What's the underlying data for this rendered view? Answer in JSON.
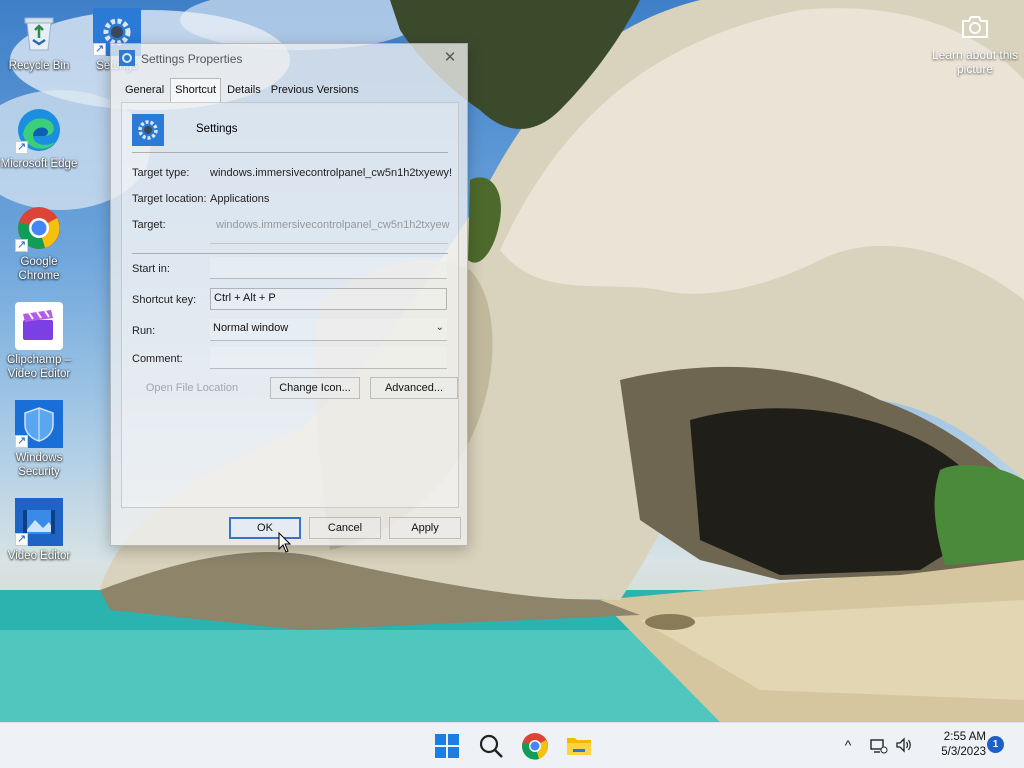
{
  "desktop": {
    "icons": [
      {
        "label": "Recycle Bin"
      },
      {
        "label": "Settings"
      },
      {
        "label": "Microsoft Edge"
      },
      {
        "label": "Google Chrome"
      },
      {
        "label": "Clipchamp – Video Editor"
      },
      {
        "label": "Windows Security"
      },
      {
        "label": "Video Editor"
      }
    ],
    "learn_about": "Learn about this picture"
  },
  "dialog": {
    "title": "Settings Properties",
    "close_symbol": "✕",
    "tabs": [
      {
        "label": "General",
        "active": false
      },
      {
        "label": "Shortcut",
        "active": true
      },
      {
        "label": "Details",
        "active": false
      },
      {
        "label": "Previous Versions",
        "active": false
      }
    ],
    "name": "Settings",
    "target_type_label": "Target type:",
    "target_type_value": "windows.immersivecontrolpanel_cw5n1h2txyewy!",
    "target_location_label": "Target location:",
    "target_location_value": "Applications",
    "target_label": "Target:",
    "target_value": "windows.immersivecontrolpanel_cw5n1h2txyew",
    "start_in_label": "Start in:",
    "start_in_value": "",
    "shortcut_key_label": "Shortcut key:",
    "shortcut_key_value": "Ctrl + Alt + P",
    "run_label": "Run:",
    "run_value": "Normal window",
    "comment_label": "Comment:",
    "comment_value": "",
    "buttons": {
      "open_file_location": "Open File Location",
      "change_icon": "Change Icon...",
      "advanced": "Advanced...",
      "ok": "OK",
      "cancel": "Cancel",
      "apply": "Apply"
    }
  },
  "taskbar": {
    "start_icon": "windows-start-icon",
    "search_icon": "search-icon",
    "chrome_icon": "chrome-icon",
    "explorer_icon": "file-explorer-icon",
    "tray_chevron": "^",
    "time": "2:55 AM",
    "date": "5/3/2023",
    "notification_count": "1"
  },
  "colors": {
    "accent": "#1e5fc8",
    "taskbar_bg": "#eef1f6"
  }
}
